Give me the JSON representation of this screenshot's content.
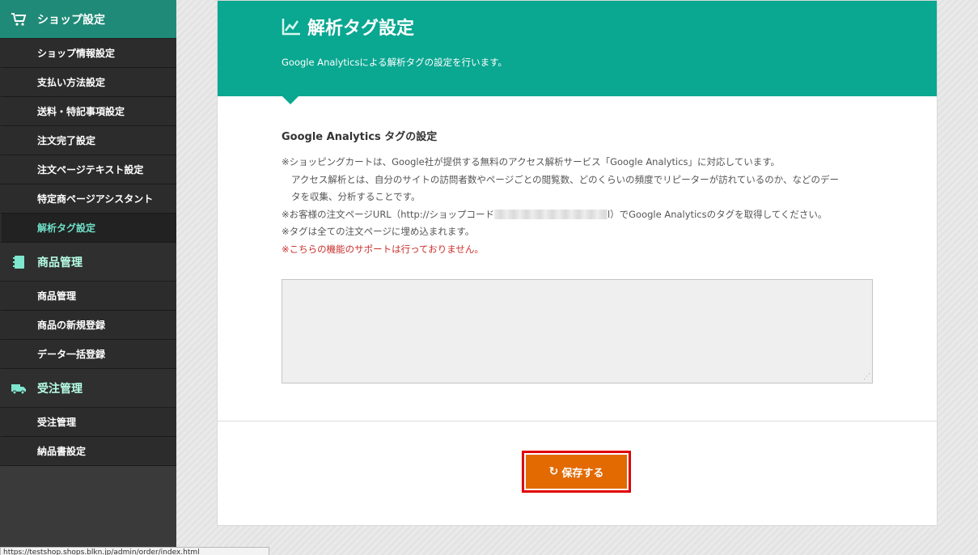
{
  "sidebar": {
    "sections": [
      {
        "label": "ショップ設定",
        "icon": "cart-icon",
        "items": [
          {
            "label": "ショップ情報設定"
          },
          {
            "label": "支払い方法設定"
          },
          {
            "label": "送料・特記事項設定"
          },
          {
            "label": "注文完了設定"
          },
          {
            "label": "注文ページテキスト設定"
          },
          {
            "label": "特定商ページアシスタント"
          },
          {
            "label": "解析タグ設定"
          }
        ]
      },
      {
        "label": "商品管理",
        "icon": "notebook-icon",
        "items": [
          {
            "label": "商品管理"
          },
          {
            "label": "商品の新規登録"
          },
          {
            "label": "データ一括登録"
          }
        ]
      },
      {
        "label": "受注管理",
        "icon": "truck-icon",
        "items": [
          {
            "label": "受注管理"
          },
          {
            "label": "納品書設定"
          }
        ]
      }
    ]
  },
  "header": {
    "title": "解析タグ設定",
    "icon": "chart-icon",
    "subtitle": "Google Analyticsによる解析タグの設定を行います。"
  },
  "main": {
    "section_heading": "Google Analytics タグの設定",
    "notes": {
      "line1": "※ショッピングカートは、Google社が提供する無料のアクセス解析サービス「Google Analytics」に対応しています。",
      "line2": "アクセス解析とは、自分のサイトの訪問者数やページごとの閲覧数、どのくらいの頻度でリピーターが訪れているのか、などのデー",
      "line3": "タを収集、分析することです。",
      "line4_a": "※お客様の注文ページURL（http://ショップコード",
      "line4_b": "l）でGoogle Analyticsのタグを取得してください。",
      "line5": "※タグは全ての注文ページに埋め込まれます。",
      "warning": "※こちらの機能のサポートは行っておりません。"
    },
    "textarea_value": "",
    "save_label": "保存する"
  },
  "status_bar": {
    "url": "https://testshop.shops.blkn.jp/admin/order/index.html"
  },
  "colors": {
    "header_bg": "#0aa791",
    "save_bg": "#e26a00",
    "warning": "#c9302c",
    "highlight_border": "#e00000"
  }
}
